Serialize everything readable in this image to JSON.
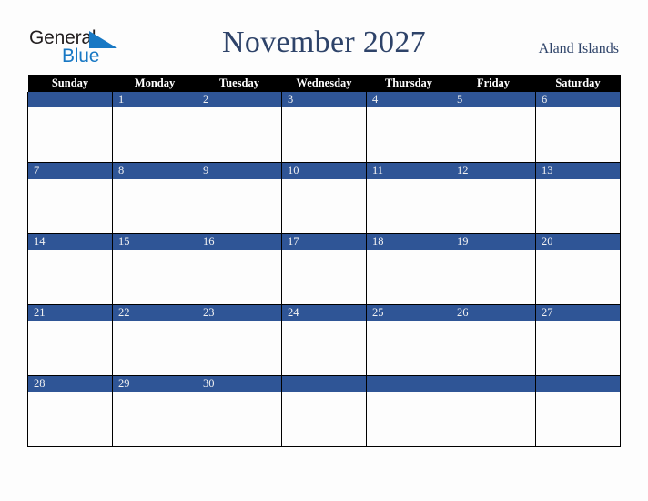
{
  "brand": {
    "name_part1": "General",
    "name_part2": "Blue",
    "triangle_icon": "blue-triangle-icon",
    "accent_color": "#1878c4",
    "text_color": "#231f20"
  },
  "header": {
    "title": "November 2027",
    "location": "Aland Islands",
    "title_color": "#2e4369"
  },
  "calendar": {
    "month": "November",
    "year": "2027",
    "header_bg": "#000000",
    "header_text_color": "#ffffff",
    "daybanner_bg": "#2f5596",
    "daybanner_text_color": "#f2f2f2",
    "cell_bg": "#fdfdfd",
    "border_color": "#000000",
    "weekday_headers": [
      "Sunday",
      "Monday",
      "Tuesday",
      "Wednesday",
      "Thursday",
      "Friday",
      "Saturday"
    ],
    "weeks": [
      [
        "",
        "1",
        "2",
        "3",
        "4",
        "5",
        "6"
      ],
      [
        "7",
        "8",
        "9",
        "10",
        "11",
        "12",
        "13"
      ],
      [
        "14",
        "15",
        "16",
        "17",
        "18",
        "19",
        "20"
      ],
      [
        "21",
        "22",
        "23",
        "24",
        "25",
        "26",
        "27"
      ],
      [
        "28",
        "29",
        "30",
        "",
        "",
        "",
        ""
      ]
    ]
  }
}
